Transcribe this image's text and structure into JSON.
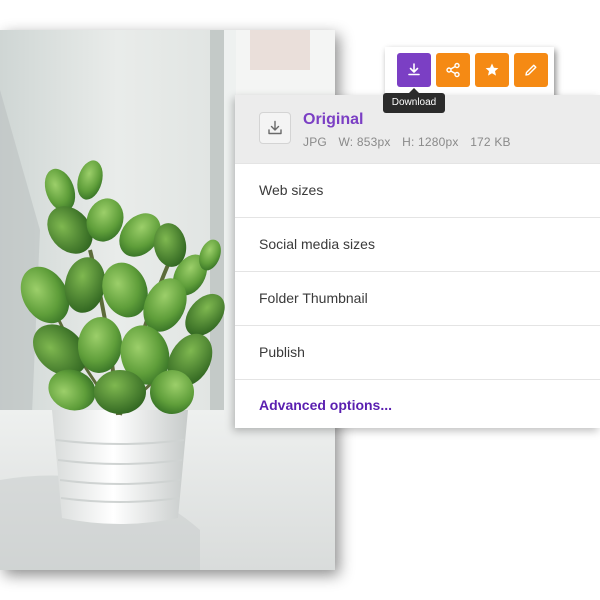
{
  "colors": {
    "accent_purple": "#7b3fc4",
    "accent_orange": "#f58a14",
    "advanced_link": "#5a1fb0",
    "tooltip_bg": "#2b2b2b"
  },
  "photo": {
    "subject": "potted jade plant in white pot on windowsill"
  },
  "toolbar": {
    "buttons": [
      {
        "icon": "download-icon",
        "color": "#7b3fc4"
      },
      {
        "icon": "share-icon",
        "color": "#f58a14"
      },
      {
        "icon": "star-icon",
        "color": "#f58a14"
      },
      {
        "icon": "pencil-icon",
        "color": "#f58a14"
      }
    ],
    "tooltip": "Download"
  },
  "download_menu": {
    "original": {
      "title": "Original",
      "format": "JPG",
      "width": "W: 853px",
      "height": "H: 1280px",
      "size": "172 KB"
    },
    "items": [
      {
        "label": "Web sizes"
      },
      {
        "label": "Social media sizes"
      },
      {
        "label": "Folder Thumbnail"
      },
      {
        "label": "Publish"
      }
    ],
    "advanced_label": "Advanced options..."
  }
}
